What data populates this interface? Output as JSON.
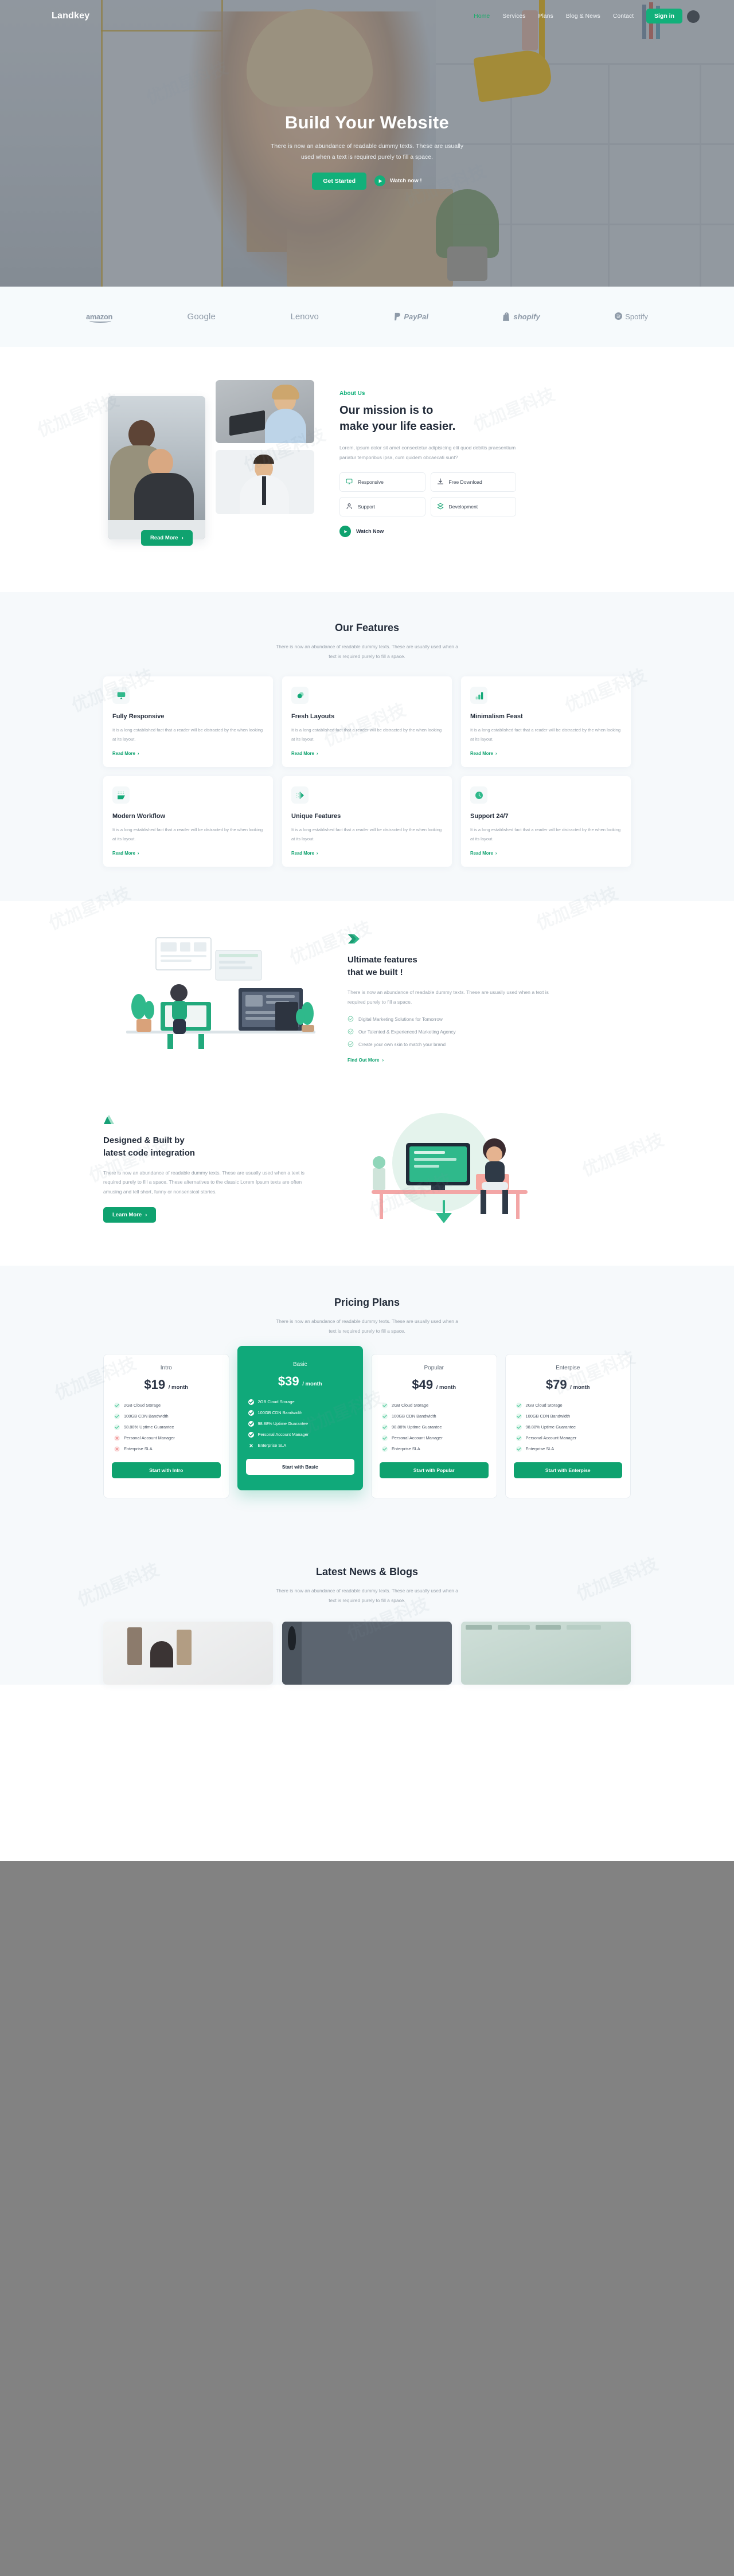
{
  "brand": {
    "name": "Landkey"
  },
  "colors": {
    "accent": "#12b07a",
    "accent_dark": "#0fa26f",
    "text": "#222b39",
    "muted": "#9aa3ad",
    "page_bg": "#f6f9fb"
  },
  "nav": {
    "items": [
      {
        "label": "Home",
        "active": true
      },
      {
        "label": "Services",
        "active": false
      },
      {
        "label": "Plans",
        "active": false
      },
      {
        "label": "Blog & News",
        "active": false
      },
      {
        "label": "Contact",
        "active": false
      }
    ],
    "signin_label": "Sign in"
  },
  "hero": {
    "title": "Build Your Website",
    "subtitle_line1": "There is now an abundance of readable dummy texts. These are usually",
    "subtitle_line2": "used when a text is required purely to fill a space.",
    "cta_label": "Get Started",
    "watch_label": "Watch now !"
  },
  "brands": {
    "items": [
      {
        "name": "amazon"
      },
      {
        "name": "Google"
      },
      {
        "name": "Lenovo"
      },
      {
        "name": "PayPal"
      },
      {
        "name": "shopify"
      },
      {
        "name": "Spotify"
      }
    ]
  },
  "about": {
    "eyebrow": "About Us",
    "heading_line1": "Our mission is to",
    "heading_line2": "make your life easier.",
    "paragraph": "Lorem, ipsum dolor sit amet consectetur adipisicing elit quod debitis praesentium pariatur temporibus ipsa, cum quidem obcaecati sunt?",
    "read_more_label": "Read More",
    "features": [
      {
        "label": "Responsive",
        "icon": "monitor-icon"
      },
      {
        "label": "Free Download",
        "icon": "download-icon"
      },
      {
        "label": "Support",
        "icon": "user-icon"
      },
      {
        "label": "Development",
        "icon": "cube-icon"
      }
    ],
    "watch_now_label": "Watch Now"
  },
  "features_section": {
    "title": "Our Features",
    "sub_line1": "There is now an abundance of readable dummy texts. These are usually used when a",
    "sub_line2": "text is required purely to fill a space.",
    "read_more_label": "Read More",
    "cards": [
      {
        "title": "Fully Responsive",
        "desc": "It is a long established fact that a reader will be distracted by the when looking at its layout.",
        "icon": "responsive-icon"
      },
      {
        "title": "Fresh Layouts",
        "desc": "It is a long established fact that a reader will be distracted by the when looking at its layout.",
        "icon": "layers-icon"
      },
      {
        "title": "Minimalism Feast",
        "desc": "It is a long established fact that a reader will be distracted by the when looking at its layout.",
        "icon": "bar-chart-icon"
      },
      {
        "title": "Modern Workflow",
        "desc": "It is a long established fact that a reader will be distracted by the when looking at its layout.",
        "icon": "workflow-icon"
      },
      {
        "title": "Unique Features",
        "desc": "It is a long established fact that a reader will be distracted by the when looking at its layout.",
        "icon": "arrow-play-icon"
      },
      {
        "title": "Support 24/7",
        "desc": "It is a long established fact that a reader will be distracted by the when looking at its layout.",
        "icon": "clock-icon"
      }
    ]
  },
  "ultimate": {
    "heading_line1": "Ultimate features",
    "heading_line2": "that we built !",
    "paragraph_line1": "There is now an abundance of readable dummy texts. These are usually",
    "paragraph_line2": "used when a text is required purely to fill a space.",
    "checks": [
      "Digital Marketing Solutions for Tomorrow",
      "Our Talented & Experienced Marketing Agency",
      "Create your own skin to match your brand"
    ],
    "link_label": "Find Out More"
  },
  "designed": {
    "heading_line1": "Designed & Built by",
    "heading_line2": "latest code integration",
    "paragraph": "There is now an abundance of readable dummy texts. These are usually used when a text is required purely to fill a space. These alternatives to the classic Lorem Ipsum texts are often amusing and tell short, funny or nonsensical stories.",
    "cta_label": "Learn More"
  },
  "pricing": {
    "title": "Pricing Plans",
    "sub_line1": "There is now an abundance of readable dummy texts. These are usually used when a",
    "sub_line2": "text is required purely to fill a space.",
    "plans": [
      {
        "name": "Intro",
        "price": "$19",
        "period": "/ month",
        "featured": false,
        "button": "Start with Intro",
        "features": [
          {
            "label": "2GB Cloud Storage",
            "included": true
          },
          {
            "label": "100GB CDN Bandwidth",
            "included": true
          },
          {
            "label": "98.88% Uptime Guarantee",
            "included": true
          },
          {
            "label": "Personal Account Manager",
            "included": false
          },
          {
            "label": "Enterprise SLA",
            "included": false
          }
        ]
      },
      {
        "name": "Basic",
        "price": "$39",
        "period": "/ month",
        "featured": true,
        "button": "Start with Basic",
        "features": [
          {
            "label": "2GB Cloud Storage",
            "included": true
          },
          {
            "label": "100GB CDN Bandwidth",
            "included": true
          },
          {
            "label": "98.88% Uptime Guarantee",
            "included": true
          },
          {
            "label": "Personal Account Manager",
            "included": true
          },
          {
            "label": "Enterprise SLA",
            "included": false
          }
        ]
      },
      {
        "name": "Popular",
        "price": "$49",
        "period": "/ month",
        "featured": false,
        "button": "Start with Popular",
        "features": [
          {
            "label": "2GB Cloud Storage",
            "included": true
          },
          {
            "label": "100GB CDN Bandwidth",
            "included": true
          },
          {
            "label": "98.88% Uptime Guarantee",
            "included": true
          },
          {
            "label": "Personal Account Manager",
            "included": true
          },
          {
            "label": "Enterprise SLA",
            "included": true
          }
        ]
      },
      {
        "name": "Enterpise",
        "price": "$79",
        "period": "/ month",
        "featured": false,
        "button": "Start with Enterpise",
        "features": [
          {
            "label": "2GB Cloud Storage",
            "included": true
          },
          {
            "label": "100GB CDN Bandwidth",
            "included": true
          },
          {
            "label": "98.88% Uptime Guarantee",
            "included": true
          },
          {
            "label": "Personal Account Manager",
            "included": true
          },
          {
            "label": "Enterprise SLA",
            "included": true
          }
        ]
      }
    ]
  },
  "blogs": {
    "title": "Latest News & Blogs",
    "sub_line1": "There is now an abundance of readable dummy texts. These are usually used when a",
    "sub_line2": "text is required purely to fill a space."
  },
  "watermark": {
    "text": "优加星科技"
  }
}
